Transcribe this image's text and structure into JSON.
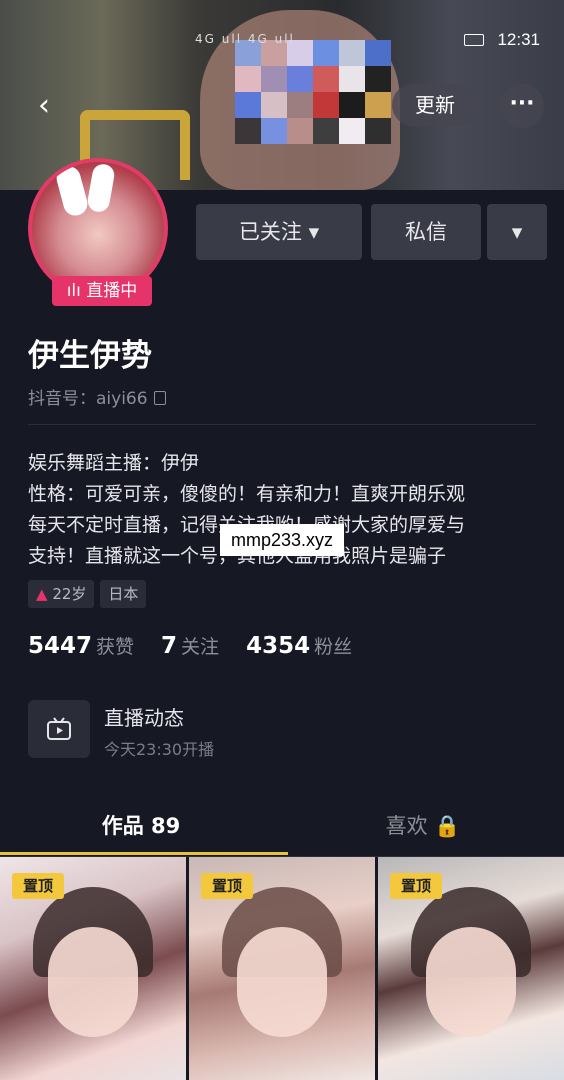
{
  "status_bar": {
    "time": "12:31",
    "signal": "4G ull 4G ull"
  },
  "header": {
    "back_icon": "chevron-left-icon",
    "update_label": "更新",
    "more_icon": "more-dots-icon"
  },
  "profile": {
    "live_badge": "ılı 直播中",
    "follow_label": "已关注 ▾",
    "message_label": "私信",
    "dropdown_label": "▾",
    "name": "伊生伊势",
    "douyin_id": "抖音号：aiyi66"
  },
  "bio": {
    "lines": [
      "娱乐舞蹈主播：伊伊",
      "性格：可爱可亲，傻傻的！有亲和力！直爽开朗乐观",
      "每天不定时直播，记得关注我哟！感谢大家的厚爱与",
      "支持！直播就这一个号，其他人盗用我照片是骗子"
    ]
  },
  "watermark": "mmp233.xyz",
  "tags": {
    "age": "22岁",
    "location": "日本"
  },
  "stats": {
    "likes_value": "5447",
    "likes_label": "获赞",
    "following_value": "7",
    "following_label": "关注",
    "fans_value": "4354",
    "fans_label": "粉丝"
  },
  "live_card": {
    "title": "直播动态",
    "subtitle": "今天23:30开播"
  },
  "tabs": {
    "works": "作品 89",
    "likes": "喜欢 🔒"
  },
  "videos": [
    {
      "pin": "置顶"
    },
    {
      "pin": "置顶"
    },
    {
      "pin": "置顶"
    }
  ],
  "colors": {
    "background": "#161824",
    "live_pink": "#e6336a",
    "accent_yellow": "#e8c23a"
  }
}
